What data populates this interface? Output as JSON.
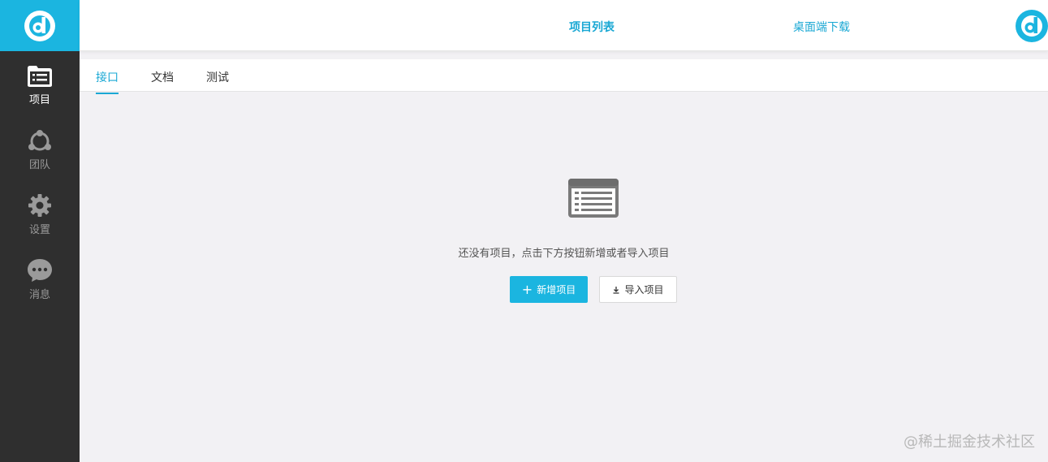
{
  "sidebar": {
    "items": [
      {
        "label": "项目",
        "icon": "folder-list-icon",
        "active": true
      },
      {
        "label": "团队",
        "icon": "team-icon",
        "active": false
      },
      {
        "label": "设置",
        "icon": "gear-icon",
        "active": false
      },
      {
        "label": "消息",
        "icon": "chat-bubble-icon",
        "active": false
      }
    ]
  },
  "header": {
    "project_list_label": "项目列表",
    "download_label": "桌面端下载"
  },
  "tabs": [
    {
      "label": "接口",
      "active": true
    },
    {
      "label": "文档",
      "active": false
    },
    {
      "label": "测试",
      "active": false
    }
  ],
  "empty_state": {
    "message": "还没有项目，点击下方按钮新增或者导入项目",
    "add_button": "新增项目",
    "import_button": "导入项目"
  },
  "watermark": "@稀土掘金技术社区",
  "colors": {
    "accent": "#1bb5e0",
    "sidebar_bg": "#2f2f2f",
    "content_bg": "#f2f1f4"
  }
}
